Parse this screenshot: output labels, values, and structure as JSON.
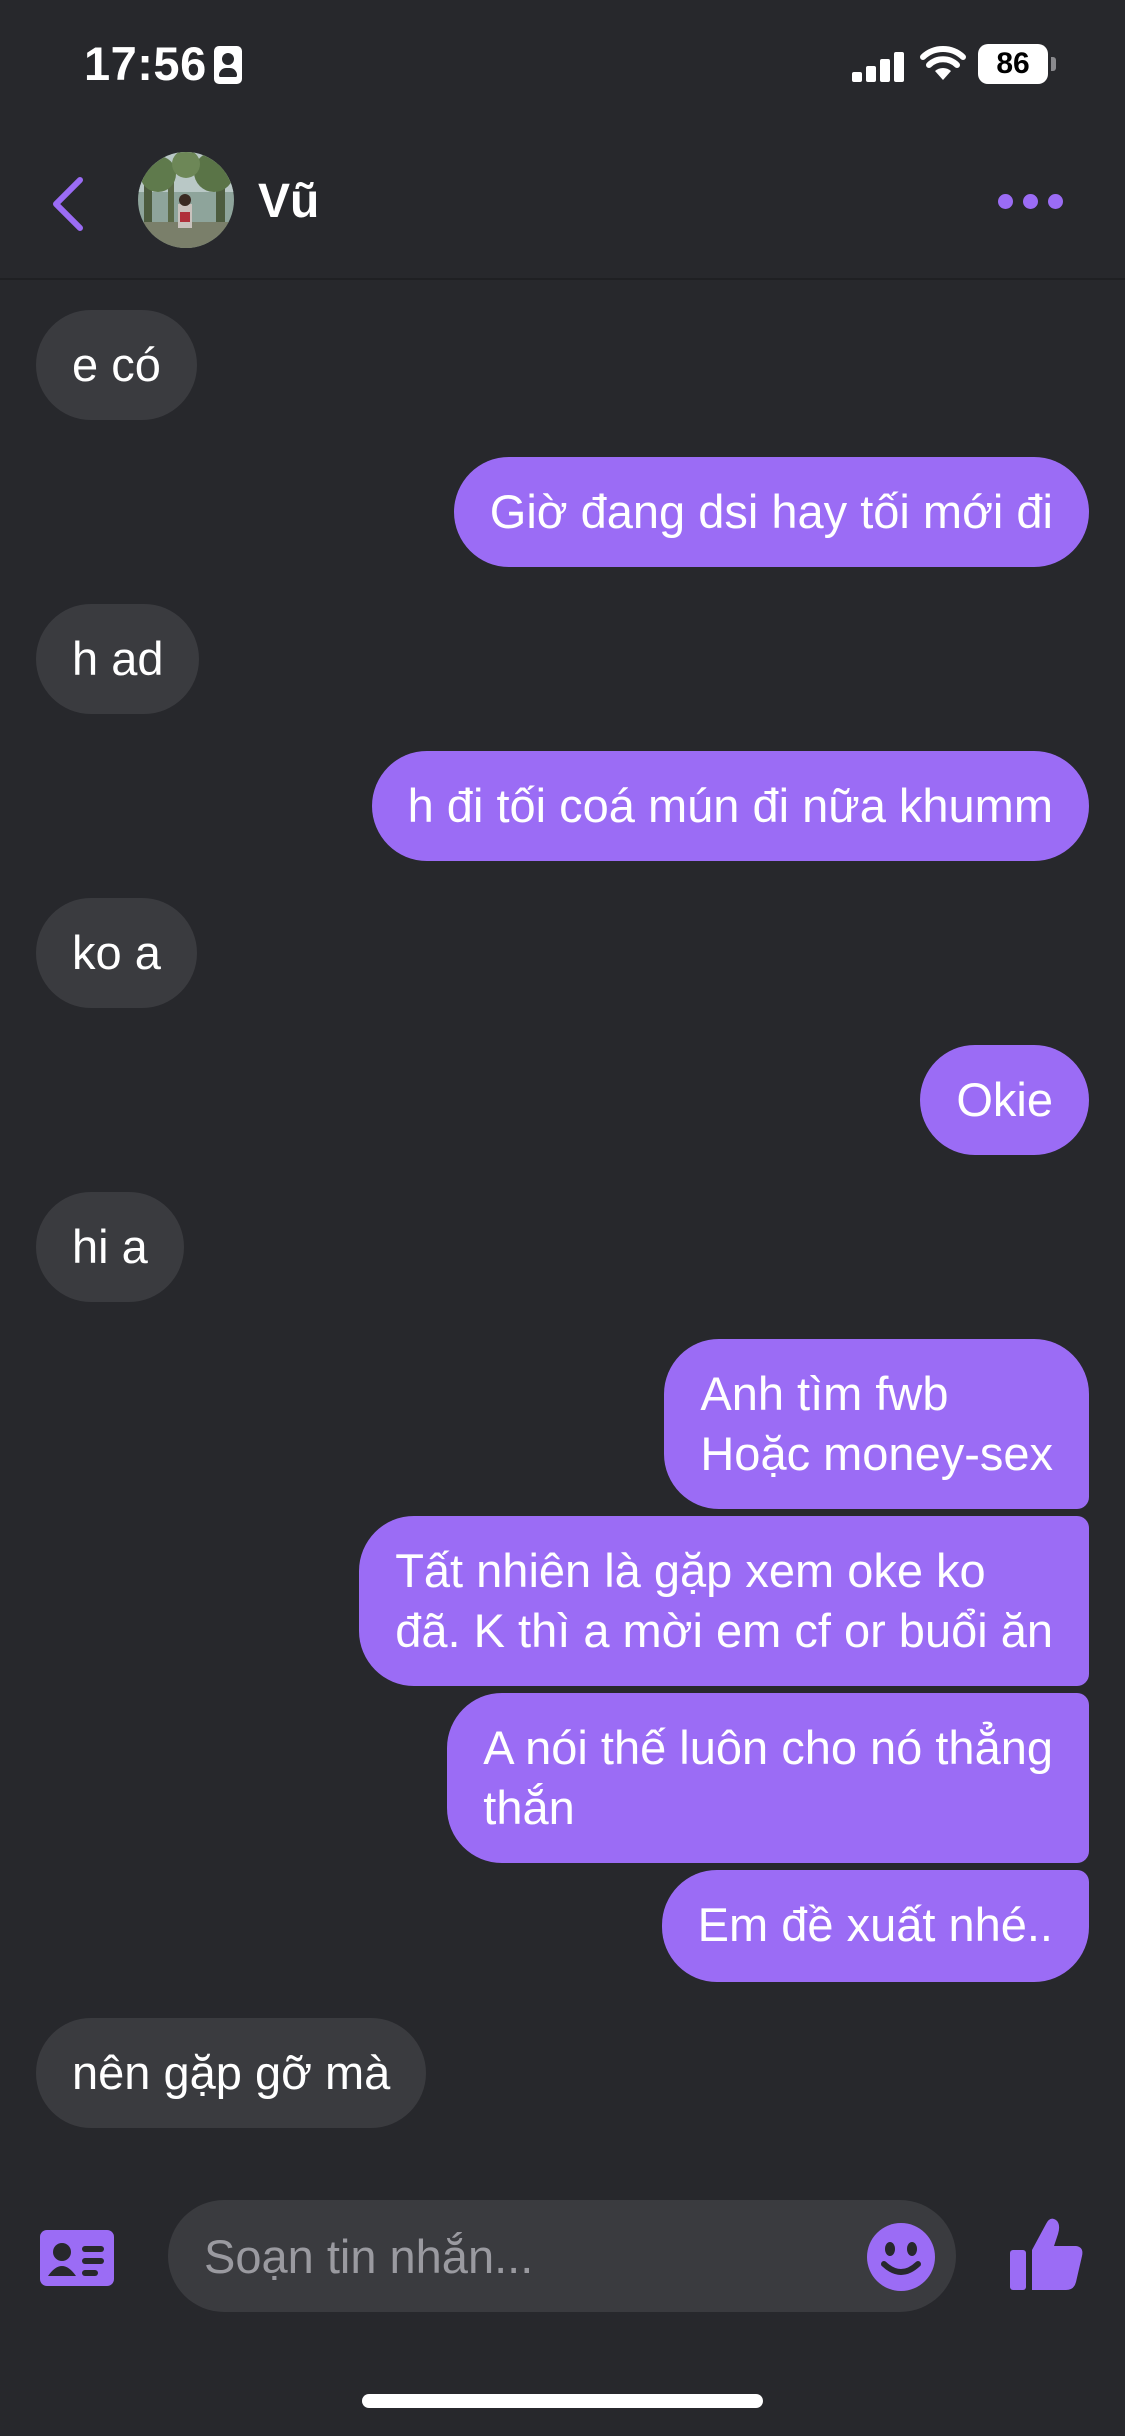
{
  "status_bar": {
    "time": "17:56",
    "battery": "86"
  },
  "header": {
    "contact_name": "Vũ"
  },
  "messages": [
    {
      "side": "incoming",
      "text": "e có"
    },
    {
      "side": "outgoing",
      "text": "Giờ đang dsi hay tối mới đi"
    },
    {
      "side": "incoming",
      "text": "h ad"
    },
    {
      "side": "outgoing",
      "text": "h đi tối coá mún đi nữa khumm"
    },
    {
      "side": "incoming",
      "text": "ko a"
    },
    {
      "side": "outgoing",
      "text": "Okie"
    },
    {
      "side": "incoming",
      "text": "hi a"
    },
    {
      "side": "outgoing",
      "text": "Anh tìm fwb\nHoặc money-sex"
    },
    {
      "side": "outgoing",
      "text": "Tất nhiên là gặp xem oke ko\nđã. K thì a mời em cf or buổi ăn"
    },
    {
      "side": "outgoing",
      "text": "A nói thế luôn cho nó thẳng\nthắn"
    },
    {
      "side": "outgoing",
      "text": "Em đề xuất nhé.."
    },
    {
      "side": "incoming",
      "text": "nên gặp gỡ mà"
    }
  ],
  "composer": {
    "placeholder": "Soạn tin nhắn..."
  },
  "icons": {
    "accent_color": "#9b6cf5",
    "back": "chevron-left-icon",
    "more": "more-horizontal-icon",
    "card": "contact-card-icon",
    "emoji": "smiley-icon",
    "like": "thumbs-up-icon"
  }
}
